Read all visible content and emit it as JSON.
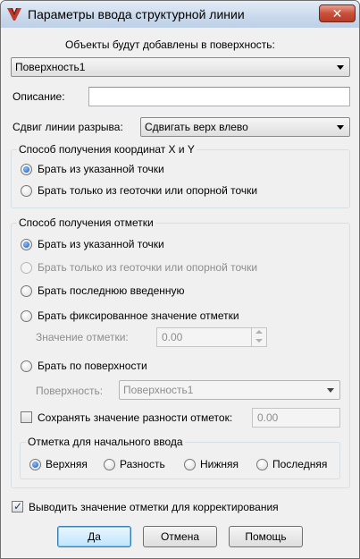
{
  "window": {
    "title": "Параметры ввода структурной линии",
    "close_symbol": "✕"
  },
  "surface_target": {
    "label": "Объекты будут добавлены в поверхность:",
    "selected": "Поверхность1"
  },
  "description": {
    "label": "Описание:",
    "value": ""
  },
  "break_shift": {
    "label": "Сдвиг линии разрыва:",
    "selected": "Сдвигать верх влево"
  },
  "xy_group": {
    "title": "Способ получения координат X и Y",
    "options": [
      {
        "label": "Брать из указанной точки",
        "checked": true,
        "enabled": true
      },
      {
        "label": "Брать только из геоточки или опорной точки",
        "checked": false,
        "enabled": true
      }
    ]
  },
  "elevation_group": {
    "title": "Способ получения отметки",
    "options": [
      {
        "label": "Брать из указанной точки",
        "checked": true,
        "enabled": true
      },
      {
        "label": "Брать только из геоточки или опорной точки",
        "checked": false,
        "enabled": false
      },
      {
        "label": "Брать последнюю введенную",
        "checked": false,
        "enabled": true
      },
      {
        "label": "Брать фиксированное значение отметки",
        "checked": false,
        "enabled": true
      },
      {
        "label": "Брать по поверхности",
        "checked": false,
        "enabled": true
      }
    ],
    "fixed_value": {
      "label": "Значение отметки:",
      "value": "0.00"
    },
    "surface": {
      "label": "Поверхность:",
      "selected": "Поверхность1"
    },
    "keep_diff": {
      "label": "Сохранять значение разности отметок:",
      "checked": false,
      "value": "0.00"
    },
    "initial": {
      "title": "Отметка для начального ввода",
      "options": [
        {
          "label": "Верхняя",
          "checked": true
        },
        {
          "label": "Разность",
          "checked": false
        },
        {
          "label": "Нижняя",
          "checked": false
        },
        {
          "label": "Последняя",
          "checked": false
        }
      ]
    }
  },
  "show_for_edit": {
    "label": "Выводить значение отметки для корректирования",
    "checked": true
  },
  "buttons": {
    "ok": "Да",
    "cancel": "Отмена",
    "help": "Помощь"
  }
}
